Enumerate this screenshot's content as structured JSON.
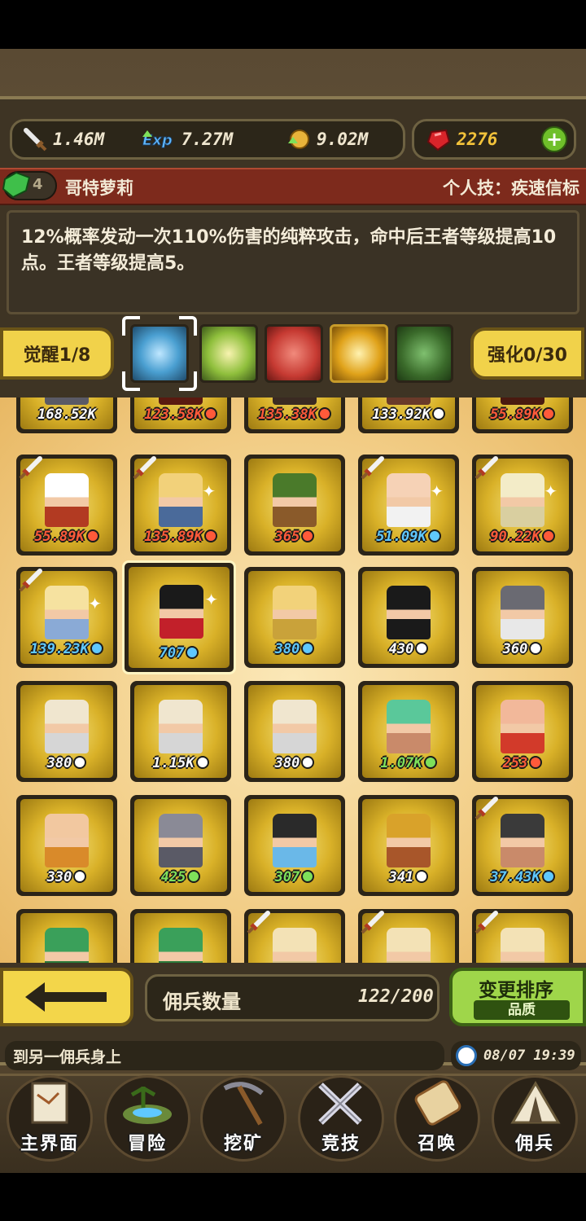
{
  "resources": {
    "attack": "1.46M",
    "exp": "7.27M",
    "gold": "9.02M",
    "gems": "2276"
  },
  "hero": {
    "level": "4",
    "name": "哥特萝莉",
    "skill": "个人技：疾速信标",
    "description": "12%概率发动一次110%伤害的纯粹攻击，命中后王者等级提高10点。王者等级提高5。"
  },
  "actions": {
    "awaken": "觉醒1/8",
    "strengthen": "强化0/30"
  },
  "mercenaries": [
    {
      "stat": "168.52K",
      "color": "white",
      "icon": "none"
    },
    {
      "stat": "123.58K",
      "color": "red",
      "icon": "r"
    },
    {
      "stat": "135.38K",
      "color": "red",
      "icon": "r"
    },
    {
      "stat": "133.92K",
      "color": "white",
      "icon": "w"
    },
    {
      "stat": "55.89K",
      "color": "red",
      "icon": "r"
    },
    {
      "stat": "55.89K",
      "color": "red",
      "icon": "r"
    },
    {
      "stat": "135.89K",
      "color": "red",
      "icon": "r"
    },
    {
      "stat": "365",
      "color": "red",
      "icon": "r"
    },
    {
      "stat": "51.09K",
      "color": "blue",
      "icon": "b"
    },
    {
      "stat": "90.22K",
      "color": "red",
      "icon": "r"
    },
    {
      "stat": "139.23K",
      "color": "blue",
      "icon": "b"
    },
    {
      "stat": "707",
      "color": "blue",
      "icon": "b"
    },
    {
      "stat": "380",
      "color": "blue",
      "icon": "b"
    },
    {
      "stat": "430",
      "color": "white",
      "icon": "w"
    },
    {
      "stat": "360",
      "color": "white",
      "icon": "w"
    },
    {
      "stat": "380",
      "color": "white",
      "icon": "w"
    },
    {
      "stat": "1.15K",
      "color": "white",
      "icon": "w"
    },
    {
      "stat": "380",
      "color": "white",
      "icon": "w"
    },
    {
      "stat": "1.07K",
      "color": "green",
      "icon": "g"
    },
    {
      "stat": "253",
      "color": "red",
      "icon": "r"
    },
    {
      "stat": "330",
      "color": "white",
      "icon": "w"
    },
    {
      "stat": "425",
      "color": "green",
      "icon": "g"
    },
    {
      "stat": "307",
      "color": "green",
      "icon": "g"
    },
    {
      "stat": "341",
      "color": "white",
      "icon": "w"
    },
    {
      "stat": "37.43K",
      "color": "blue",
      "icon": "b"
    }
  ],
  "bottom": {
    "count_label": "佣兵数量",
    "count_value": "122/200",
    "sort_label": "变更排序",
    "sort_sub": "品质",
    "ticker": "到另一佣兵身上",
    "datetime": "08/07 19:39"
  },
  "nav": [
    {
      "label": "主界面",
      "icon": "map-scroll-icon"
    },
    {
      "label": "冒险",
      "icon": "island-icon"
    },
    {
      "label": "挖矿",
      "icon": "pickaxe-icon"
    },
    {
      "label": "竞技",
      "icon": "crossed-swords-icon"
    },
    {
      "label": "召唤",
      "icon": "summon-scroll-icon"
    },
    {
      "label": "佣兵",
      "icon": "tent-icon"
    }
  ],
  "colors": {
    "gold_card": "#d9b128",
    "name_bar": "#7d2a1c",
    "sort_button": "#9fd64a",
    "gem_text": "#f2c23a"
  }
}
